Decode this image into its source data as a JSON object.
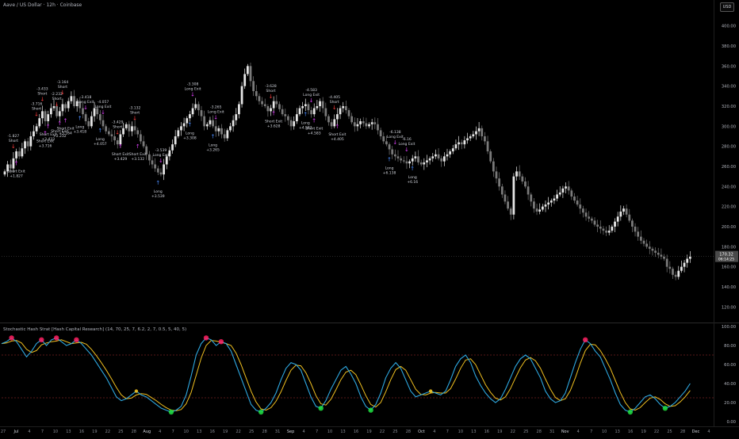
{
  "header": {
    "symbol_title": "Aave / US Dollar · 12h · Coinbase",
    "currency_button": "USD"
  },
  "indicator": {
    "title": "Stochastic Hash Strat [Hash Capital Research]",
    "params": "(14, 70, 25, 7, 6.2, 2, 7, 0.5, 5, 40, 5)"
  },
  "colors": {
    "background": "#000000",
    "candle_up": "#e6e6e6",
    "candle_down": "#7a7a7a",
    "long_arrow": "#4c8dff",
    "short_arrow": "#ff3b3b",
    "exit_arrow": "#e040fb",
    "k_line": "#2ea8e0",
    "d_line": "#f0c020",
    "overbought_dot": "#ff2060",
    "oversold_dot": "#20e040",
    "band_line": "#b03030",
    "price_tag": "#4a4a4a"
  },
  "price_axis": {
    "ticks": [
      "400.00",
      "380.00",
      "360.00",
      "340.00",
      "320.00",
      "300.00",
      "280.00",
      "260.00",
      "240.00",
      "220.00",
      "200.00",
      "180.00",
      "160.00",
      "140.00",
      "120.00"
    ],
    "last_price": "170.32",
    "last_sub": "06:14:25"
  },
  "osc_axis": {
    "ticks": [
      "100.00",
      "80.00",
      "60.00",
      "40.00",
      "20.00",
      "0.00"
    ]
  },
  "x_axis": {
    "ticks": [
      "27",
      "Jul",
      "4",
      "7",
      "10",
      "13",
      "16",
      "19",
      "22",
      "25",
      "28",
      "Aug",
      "4",
      "7",
      "10",
      "13",
      "16",
      "19",
      "22",
      "25",
      "28",
      "31",
      "Sep",
      "4",
      "7",
      "10",
      "13",
      "16",
      "19",
      "22",
      "25",
      "28",
      "Oct",
      "4",
      "7",
      "10",
      "13",
      "16",
      "19",
      "22",
      "25",
      "28",
      "31",
      "Nov",
      "4",
      "7",
      "10",
      "13",
      "16",
      "19",
      "22",
      "25",
      "28",
      "Dec",
      "4"
    ]
  },
  "chart_data": [
    {
      "type": "candlestick",
      "title": "Aave / US Dollar · 12h · Coinbase",
      "ylim": [
        110,
        410
      ],
      "close": [
        255,
        262,
        258,
        268,
        275,
        270,
        278,
        285,
        280,
        290,
        295,
        300,
        308,
        315,
        305,
        312,
        318,
        320,
        310,
        315,
        322,
        318,
        325,
        330,
        320,
        325,
        318,
        312,
        305,
        300,
        310,
        318,
        312,
        306,
        300,
        295,
        292,
        290,
        286,
        282,
        292,
        298,
        302,
        295,
        300,
        296,
        292,
        285,
        280,
        272,
        266,
        262,
        258,
        254,
        252,
        262,
        270,
        276,
        282,
        290,
        296,
        300,
        303,
        308,
        312,
        318,
        322,
        316,
        310,
        300,
        302,
        306,
        300,
        295,
        298,
        292,
        288,
        296,
        300,
        306,
        312,
        322,
        340,
        352,
        360,
        345,
        335,
        330,
        325,
        322,
        320,
        315,
        318,
        325,
        322,
        317,
        312,
        310,
        306,
        300,
        305,
        312,
        318,
        320,
        322,
        316,
        312,
        318,
        320,
        325,
        318,
        310,
        304,
        300,
        307,
        312,
        318,
        320,
        316,
        310,
        304,
        300,
        302,
        305,
        303,
        300,
        302,
        304,
        302,
        296,
        290,
        285,
        282,
        277,
        272,
        270,
        268,
        266,
        265,
        263,
        265,
        268,
        270,
        264,
        262,
        264,
        266,
        268,
        270,
        272,
        268,
        265,
        270,
        272,
        275,
        278,
        282,
        284,
        282,
        286,
        288,
        290,
        292,
        295,
        298,
        290,
        285,
        275,
        265,
        255,
        248,
        240,
        232,
        225,
        218,
        212,
        250,
        255,
        250,
        245,
        240,
        232,
        225,
        218,
        215,
        217,
        220,
        222,
        224,
        226,
        228,
        232,
        234,
        238,
        240,
        236,
        230,
        226,
        222,
        218,
        214,
        210,
        208,
        206,
        202,
        200,
        198,
        196,
        194,
        196,
        200,
        205,
        210,
        215,
        218,
        212,
        206,
        200,
        195,
        190,
        186,
        183,
        180,
        178,
        176,
        174,
        172,
        170,
        168,
        160,
        158,
        152,
        150,
        156,
        160,
        164,
        168,
        170
      ],
      "signals": [
        {
          "type": "short",
          "label": "-1.827",
          "sub": "Short"
        },
        {
          "type": "exit",
          "label": "Short Exit",
          "sub": "+1.827"
        },
        {
          "type": "short",
          "label": "-3.716",
          "sub": "Short"
        },
        {
          "type": "short",
          "label": "-3.433",
          "sub": "Short"
        },
        {
          "type": "exit",
          "label": "Short Exit",
          "sub": "+3.716"
        },
        {
          "type": "exit",
          "label": "Short Exit",
          "sub": "+3.433"
        },
        {
          "type": "short",
          "label": "-2.232",
          "sub": "Short"
        },
        {
          "type": "short",
          "label": "-3.164",
          "sub": "Short"
        },
        {
          "type": "exit",
          "label": "Short Exit",
          "sub": "+2.232"
        },
        {
          "type": "exit",
          "label": "Short Exit",
          "sub": "+3.164"
        },
        {
          "type": "long",
          "label": "Long",
          "sub": "+3.418"
        },
        {
          "type": "exit",
          "label": "-3.418",
          "sub": "Long Exit"
        },
        {
          "type": "long",
          "label": "Long",
          "sub": "+4.057"
        },
        {
          "type": "exit",
          "label": "-4.057",
          "sub": "Long Exit"
        },
        {
          "type": "short",
          "label": "-3.429",
          "sub": "Short"
        },
        {
          "type": "exit",
          "label": "Short Exit",
          "sub": "+3.429"
        },
        {
          "type": "short",
          "label": "-3.132",
          "sub": "Short"
        },
        {
          "type": "exit",
          "label": "Short Exit",
          "sub": "+3.132"
        },
        {
          "type": "long",
          "label": "Long",
          "sub": "+3.539"
        },
        {
          "type": "exit",
          "label": "-3.539",
          "sub": "Long Exit"
        },
        {
          "type": "long",
          "label": "Long",
          "sub": "+3.308"
        },
        {
          "type": "exit",
          "label": "-3.308",
          "sub": "Long Exit"
        },
        {
          "type": "long",
          "label": "Long",
          "sub": "+3.265"
        },
        {
          "type": "exit",
          "label": "-3.265",
          "sub": "Long Exit"
        },
        {
          "type": "short",
          "label": "-3.628",
          "sub": "Short"
        },
        {
          "type": "exit",
          "label": "Short Exit",
          "sub": "+3.628"
        },
        {
          "type": "long",
          "label": "Long",
          "sub": "+4.583"
        },
        {
          "type": "exit",
          "label": "-4.583",
          "sub": "Long Exit"
        },
        {
          "type": "exit",
          "label": "Short Exit",
          "sub": "+4.583"
        },
        {
          "type": "short",
          "label": "-4.405",
          "sub": "Short"
        },
        {
          "type": "exit",
          "label": "Short Exit",
          "sub": "+4.405"
        },
        {
          "type": "exit",
          "label": "-6.138",
          "sub": "Long Exit"
        },
        {
          "type": "long",
          "label": "Long",
          "sub": "+6.138"
        },
        {
          "type": "exit",
          "label": "-6.16",
          "sub": "Long Exit"
        },
        {
          "type": "long",
          "label": "Long",
          "sub": "+6.16"
        }
      ]
    },
    {
      "type": "line",
      "title": "Stochastic Hash Strat [Hash Capital Research]",
      "ylim": [
        0,
        100
      ],
      "levels": [
        70,
        25
      ],
      "series": [
        {
          "values": [
            82,
            84,
            88,
            84,
            76,
            68,
            74,
            82,
            86,
            80,
            86,
            88,
            84,
            80,
            82,
            86,
            82,
            76,
            70,
            62,
            54,
            46,
            36,
            26,
            22,
            24,
            28,
            32,
            28,
            26,
            22,
            18,
            14,
            12,
            10,
            12,
            16,
            28,
            48,
            70,
            82,
            88,
            86,
            80,
            84,
            82,
            74,
            60,
            46,
            32,
            18,
            12,
            10,
            14,
            20,
            30,
            44,
            56,
            62,
            60,
            54,
            40,
            26,
            16,
            14,
            22,
            34,
            44,
            54,
            58,
            50,
            40,
            26,
            16,
            12,
            18,
            30,
            46,
            56,
            62,
            56,
            44,
            32,
            26,
            28,
            30,
            32,
            30,
            28,
            32,
            44,
            58,
            66,
            70,
            62,
            48,
            38,
            30,
            24,
            20,
            24,
            34,
            46,
            58,
            66,
            70,
            66,
            56,
            46,
            32,
            24,
            20,
            22,
            30,
            46,
            62,
            76,
            86,
            82,
            74,
            68,
            56,
            44,
            30,
            18,
            12,
            10,
            14,
            20,
            26,
            28,
            24,
            18,
            14,
            16,
            20,
            26,
            32,
            40
          ]
        }
      ]
    }
  ]
}
